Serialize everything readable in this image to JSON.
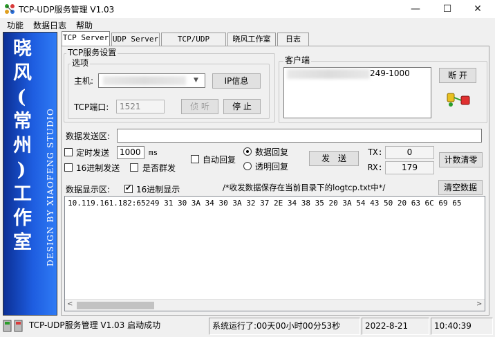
{
  "window": {
    "title": "TCP-UDP服务管理 V1.03",
    "minimize_symbol": "—",
    "maximize_symbol": "☐",
    "close_symbol": "✕"
  },
  "menu": [
    "功能",
    "数据日志",
    "帮助"
  ],
  "sidebar": {
    "title_cn": [
      "晓",
      "风",
      "(",
      "常",
      "州",
      ")",
      "工",
      "作",
      "室"
    ],
    "title_en": "DESIGN BY XIAOFENG STUDIO"
  },
  "tabs": [
    {
      "label": "TCP Server",
      "active": true
    },
    {
      "label": "UDP Server",
      "active": false
    },
    {
      "label": "TCP/UDP Client",
      "active": false
    },
    {
      "label": "晓风工作室",
      "active": false
    },
    {
      "label": "日志",
      "active": false
    }
  ],
  "server_settings": {
    "group_label": "TCP服务设置",
    "options_label": "选项",
    "host_label": "主机:",
    "host_value": "",
    "ip_info_button": "IP信息",
    "port_label": "TCP端口:",
    "port_value": "1521",
    "listen_button": "侦 听",
    "stop_button": "停 止"
  },
  "clients": {
    "group_label": "客户端",
    "entry_suffix": "249-1000",
    "disconnect_button": "断 开"
  },
  "send": {
    "label": "数据发送区:",
    "value": "",
    "timed_send_label": "定时发送",
    "interval_value": "1000",
    "interval_unit": "ms",
    "hex_send_label": "16进制发送",
    "group_send_label": "是否群发",
    "auto_reply_label": "自动回复",
    "data_reply_label": "数据回复",
    "transparent_reply_label": "透明回复",
    "send_button": "发　送",
    "tx_label": "TX:",
    "tx_value": "0",
    "rx_label": "RX:",
    "rx_value": "179",
    "clear_count_button": "计数清零"
  },
  "display": {
    "label": "数据显示区:",
    "hex_display_label": "16进制显示",
    "hex_display_checked": true,
    "note": "/*收发数据保存在当前目录下的logtcp.txt中*/",
    "clear_button": "清空数据",
    "content": "10.119.161.182:65249 31 30 3A 34 30 3A 32 37 2E 34 38 35 20 3A 54 43 50 20 63 6C 69 65"
  },
  "status": {
    "app_status": "TCP-UDP服务管理 V1.03 启动成功",
    "uptime": "系统运行了:00天00小时00分53秒",
    "date": "2022-8-21",
    "time": "10:40:39"
  },
  "colors": {
    "sidebar_dark": "#0b2f95",
    "sidebar_light": "#2f7bf5",
    "window_bg": "#f0f0f0"
  }
}
